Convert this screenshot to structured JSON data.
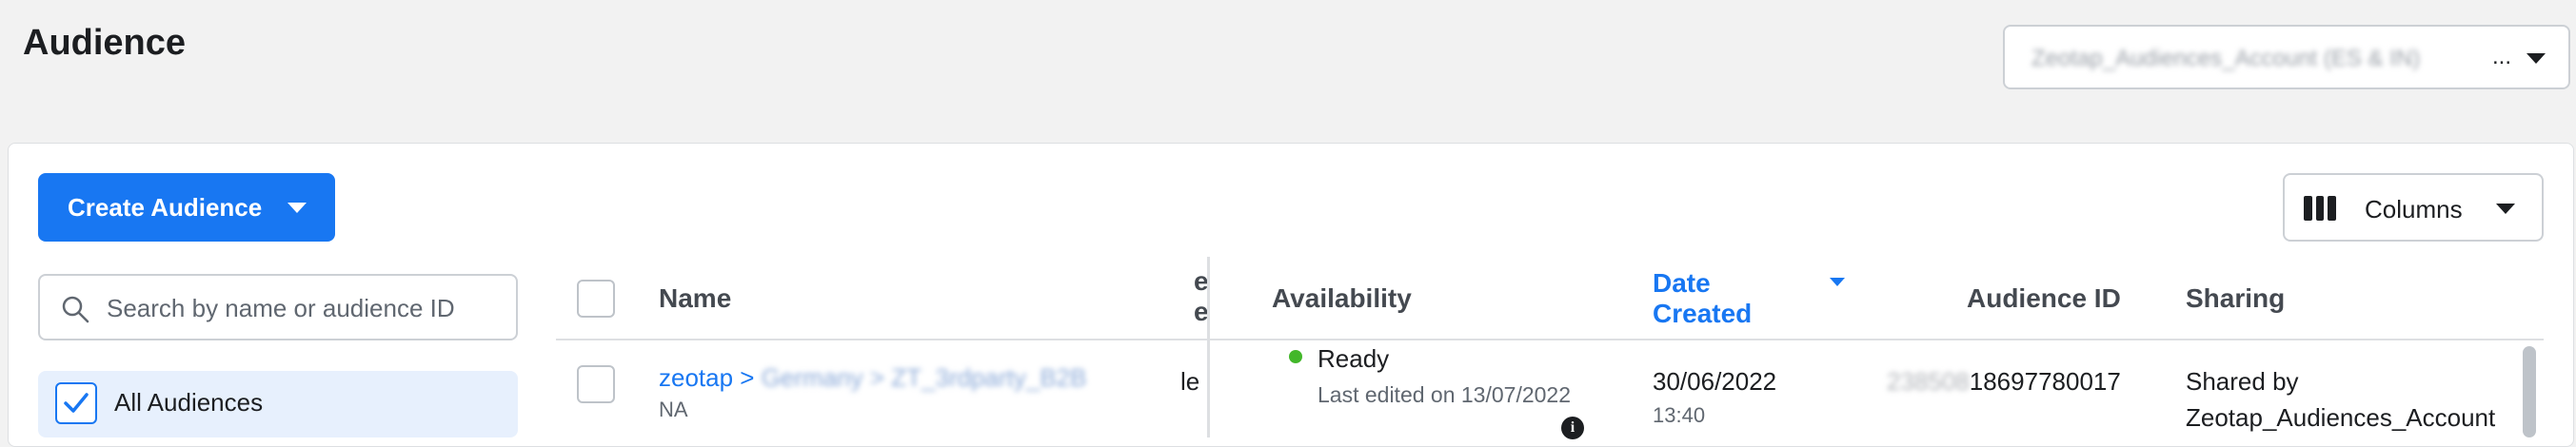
{
  "page": {
    "title": "Audience"
  },
  "account": {
    "name": "Zeotap_Audiences_Account (ES & IN)",
    "ellipsis": "..."
  },
  "toolbar": {
    "create_label": "Create Audience",
    "columns_label": "Columns"
  },
  "sidebar": {
    "search_placeholder": "Search by name or audience ID",
    "filters": [
      {
        "label": "All Audiences",
        "checked": true
      }
    ]
  },
  "table": {
    "headers": {
      "name": "Name",
      "hidden_fragment_1": "e",
      "hidden_fragment_2": "e",
      "availability": "Availability",
      "date_created_line1": "Date",
      "date_created_line2": "Created",
      "audience_id": "Audience ID",
      "sharing": "Sharing"
    },
    "sort": {
      "column": "Date Created",
      "direction": "descending"
    },
    "rows": [
      {
        "name_prefix": "zeotap > ",
        "name_rest": "Germany > ZT_3rdparty_B2B",
        "name_sub": "NA",
        "type_fragment": "le",
        "availability": "Ready",
        "last_edited": "Last edited on 13/07/2022",
        "date": "30/06/2022",
        "time": "13:40",
        "audience_id_hidden": "238508",
        "audience_id_visible": "18697780017",
        "sharing_line1": "Shared by",
        "sharing_line2": "Zeotap_Audiences_Account"
      }
    ]
  },
  "colors": {
    "accent": "#1877f2",
    "ready": "#42b72a",
    "background": "#f2f2f2"
  }
}
